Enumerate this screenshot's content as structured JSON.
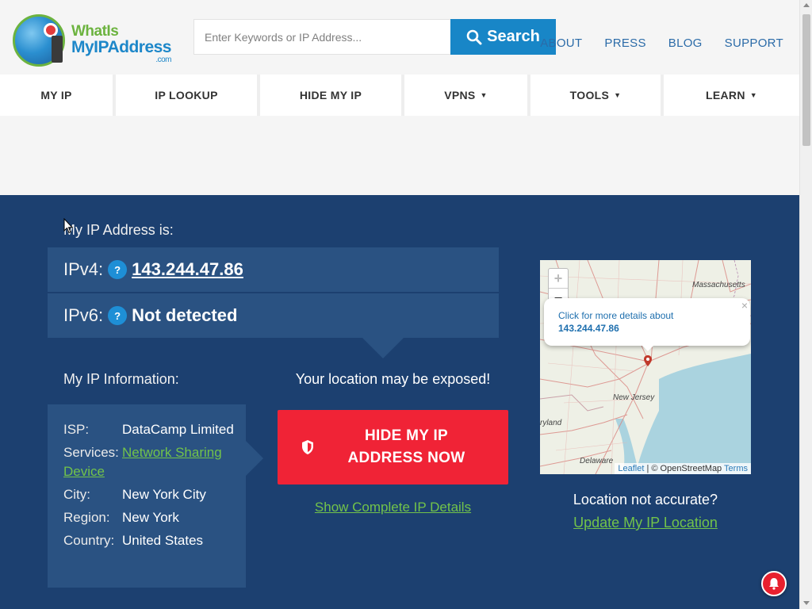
{
  "header": {
    "logo": {
      "line1": "WhatIs",
      "line2": "MyIPAddress",
      "line3": ".com"
    },
    "search": {
      "placeholder": "Enter Keywords or IP Address...",
      "button_label": "Search"
    },
    "top_links": [
      "ABOUT",
      "PRESS",
      "BLOG",
      "SUPPORT"
    ]
  },
  "nav": [
    {
      "label": "MY IP",
      "has_dropdown": false
    },
    {
      "label": "IP LOOKUP",
      "has_dropdown": false
    },
    {
      "label": "HIDE MY IP",
      "has_dropdown": false
    },
    {
      "label": "VPNS",
      "has_dropdown": true
    },
    {
      "label": "TOOLS",
      "has_dropdown": true
    },
    {
      "label": "LEARN",
      "has_dropdown": true
    }
  ],
  "main": {
    "my_ip_label": "My IP Address is:",
    "ipv4": {
      "label": "IPv4:",
      "help": "?",
      "value": "143.244.47.86"
    },
    "ipv6": {
      "label": "IPv6:",
      "help": "?",
      "value": "Not detected"
    },
    "info_label": "My IP Information:",
    "info": {
      "isp_label": "ISP:",
      "isp_value": "DataCamp Limited",
      "services_label": "Services:",
      "services_value": "Network Sharing Device",
      "city_label": "City:",
      "city_value": "New York City",
      "region_label": "Region:",
      "region_value": "New York",
      "country_label": "Country:",
      "country_value": "United States"
    },
    "exposed_text": "Your location may be exposed!",
    "hide_button": "HIDE MY IP ADDRESS NOW",
    "details_link": "Show Complete IP Details",
    "map": {
      "zoom_in": "+",
      "zoom_out": "−",
      "popup_text": "Click for more details about",
      "popup_ip": "143.244.47.86",
      "popup_close": "×",
      "labels": {
        "massachusetts": "Massachusetts",
        "new_jersey": "New Jersey",
        "maryland": "ryland",
        "delaware": "Delaware"
      },
      "attrib_leaflet": "Leaflet",
      "attrib_sep": " | © OpenStreetMap ",
      "attrib_terms": "Terms"
    },
    "not_accurate": "Location not accurate?",
    "update_link": "Update My IP Location"
  },
  "colors": {
    "brand_blue": "#1886c7",
    "main_bg": "#1c4070",
    "panel_bg": "#2a5282",
    "cta_red": "#f02336",
    "link_green": "#72c34a"
  }
}
